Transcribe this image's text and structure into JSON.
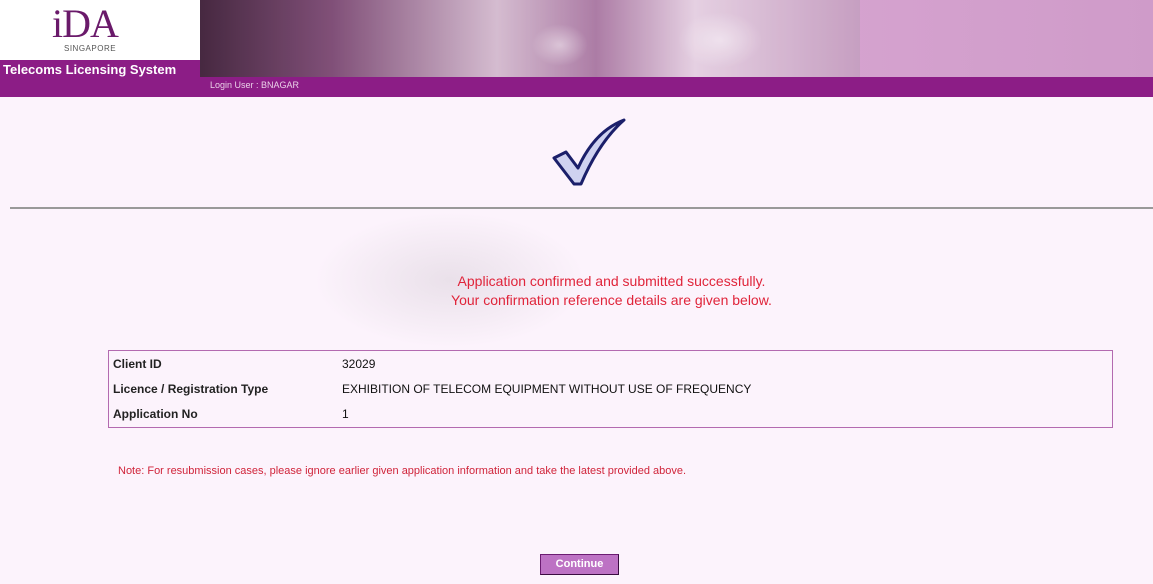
{
  "header": {
    "logo": "iDA",
    "logo_sub": "SINGAPORE",
    "app_title": "Telecoms Licensing System",
    "login_user": "Login User : BNAGAR"
  },
  "message": {
    "line1": "Application confirmed and submitted successfully.",
    "line2": "Your confirmation reference details are given below."
  },
  "details": {
    "rows": [
      {
        "label": "Client ID",
        "value": "32029"
      },
      {
        "label": "Licence / Registration Type",
        "value": "EXHIBITION OF TELECOM EQUIPMENT WITHOUT USE OF FREQUENCY"
      },
      {
        "label": "Application No",
        "value": "1"
      }
    ]
  },
  "note": "Note: For resubmission cases, please ignore earlier given application information and take the latest provided above.",
  "continue_label": "Continue",
  "colors": {
    "brand": "#8c1d86",
    "message": "#e0243a",
    "button": "#bd72c4"
  }
}
